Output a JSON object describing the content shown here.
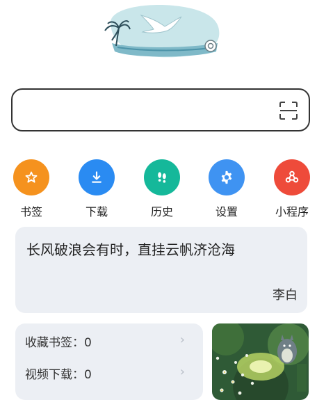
{
  "search": {
    "placeholder": ""
  },
  "quick_actions": [
    {
      "label": "书签",
      "icon": "star-icon",
      "color": "#f5921e"
    },
    {
      "label": "下载",
      "icon": "download-icon",
      "color": "#2a8bf2"
    },
    {
      "label": "历史",
      "icon": "footprints-icon",
      "color": "#15b89a"
    },
    {
      "label": "设置",
      "icon": "gear-icon",
      "color": "#3f93f2"
    },
    {
      "label": "小程序",
      "icon": "mini-program-icon",
      "color": "#ee4b3a"
    }
  ],
  "quote": {
    "text": "长风破浪会有时，直挂云帆济沧海",
    "author": "李白"
  },
  "stats": [
    {
      "label": "收藏书签：0"
    },
    {
      "label": "视频下载：0"
    }
  ]
}
